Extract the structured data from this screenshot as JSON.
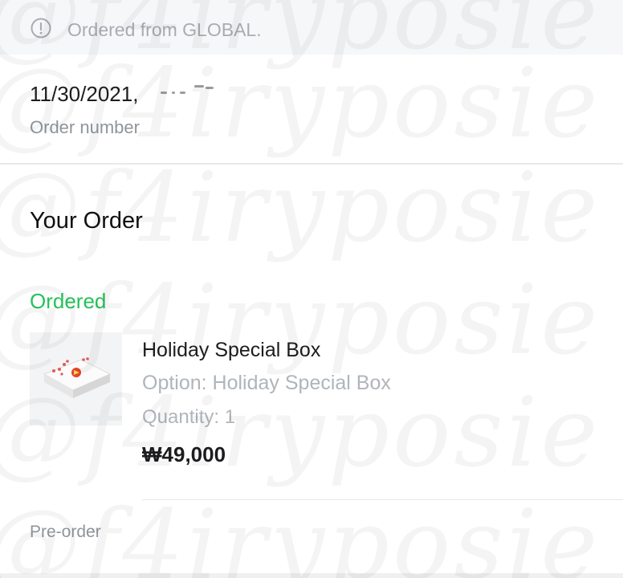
{
  "notice": {
    "icon": "info-circle-icon",
    "text": "Ordered from GLOBAL."
  },
  "order": {
    "date": "11/30/2021,",
    "number_label": "Order number"
  },
  "section": {
    "title": "Your Order"
  },
  "status": {
    "label": "Ordered",
    "color": "#25c25a"
  },
  "product": {
    "name": "Holiday Special Box",
    "option": "Option: Holiday Special Box",
    "quantity": "Quantity: 1",
    "price": "₩49,000",
    "thumbnail_icon": "product-thumbnail"
  },
  "footer": {
    "preorder": "Pre-order"
  },
  "watermark": {
    "text": "@f4iryposie"
  }
}
